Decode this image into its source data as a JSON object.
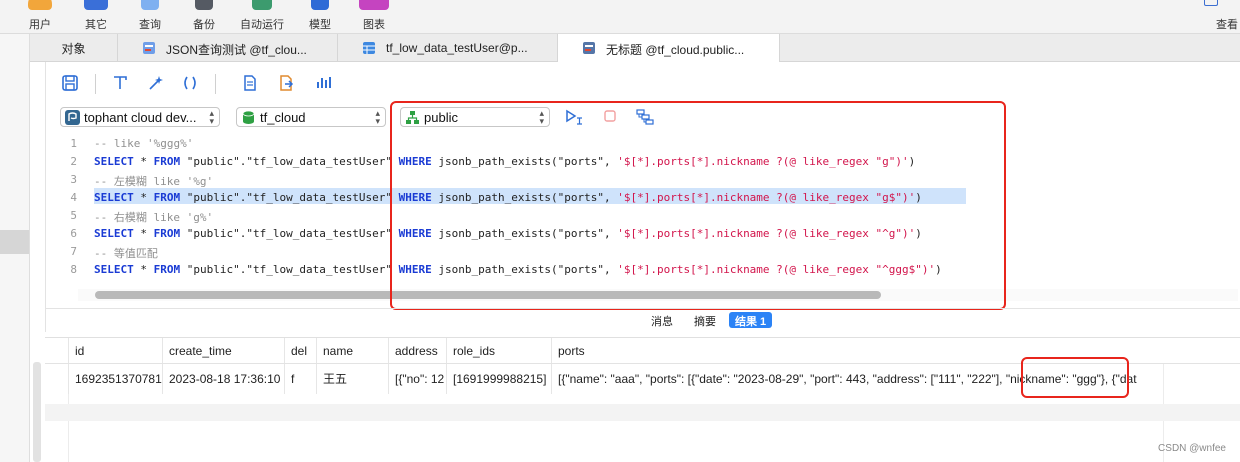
{
  "toolbar": {
    "items": [
      {
        "label": "用户",
        "icon": "user-icon",
        "color": "#f2a63b"
      },
      {
        "label": "其它",
        "icon": "other-icon",
        "color": "#3a6fd8"
      },
      {
        "label": "查询",
        "icon": "query-icon",
        "color": "#7fb0f0"
      },
      {
        "label": "备份",
        "icon": "backup-icon",
        "color": "#555a63"
      },
      {
        "label": "自动运行",
        "icon": "automation-icon",
        "color": "#3c9b6e"
      },
      {
        "label": "模型",
        "icon": "model-icon",
        "color": "#2e6bd6"
      },
      {
        "label": "图表",
        "icon": "chart-icon",
        "color": "#c544c0"
      }
    ],
    "right_label": "查看"
  },
  "tabs": [
    {
      "label": "对象",
      "icon": ""
    },
    {
      "label": "JSON查询测试 @tf_clou...",
      "icon": "query-icon"
    },
    {
      "label": "tf_low_data_testUser@p...",
      "icon": "table-icon"
    },
    {
      "label": "无标题 @tf_cloud.public...",
      "icon": "query-icon",
      "active": true
    }
  ],
  "selectors": {
    "connection": "tophant cloud dev...",
    "database": "tf_cloud",
    "schema": "public"
  },
  "code": {
    "line_numbers": [
      "1",
      "2",
      "3",
      "4",
      "5",
      "6",
      "7",
      "8"
    ],
    "comments": {
      "c1": "-- like '%ggg%'",
      "c3": "-- 左模糊 like '%g'",
      "c5": "-- 右模糊 like 'g%'",
      "c7": "-- 等值匹配"
    },
    "kw_select": "SELECT",
    "star_from": " * ",
    "kw_from": "FROM",
    "table": " \"public\".\"tf_low_data_testUser\" ",
    "kw_where": "WHERE",
    "func": " jsonb_path_exists(\"ports\", ",
    "paths": {
      "p2": "'$[*].ports[*].nickname ?(@ like_regex \"g\")'",
      "p4": "'$[*].ports[*].nickname ?(@ like_regex \"g$\")'",
      "p6": "'$[*].ports[*].nickname ?(@ like_regex \"^g\")'",
      "p8": "'$[*].ports[*].nickname ?(@ like_regex \"^ggg$\")'"
    },
    "close": ")"
  },
  "result_tabs": [
    "消息",
    "摘要",
    "结果 1"
  ],
  "grid": {
    "columns": [
      "id",
      "create_time",
      "del",
      "name",
      "address",
      "role_ids",
      "ports"
    ],
    "rows": [
      [
        "1692351370781",
        "2023-08-18 17:36:10",
        "f",
        "王五",
        "[{\"no\": 12",
        "[1691999988215]",
        "[{\"name\": \"aaa\", \"ports\": [{\"date\": \"2023-08-29\", \"port\": 443, \"address\": [\"111\", \"222\"], \"nickname\": \"ggg\"}, {\"dat"
      ]
    ]
  },
  "watermark": "CSDN @wnfee",
  "colors": {
    "accent": "#2b83f6",
    "annotation": "#e8251c",
    "keyword": "#1a3bd4",
    "string": "#d2144b"
  }
}
